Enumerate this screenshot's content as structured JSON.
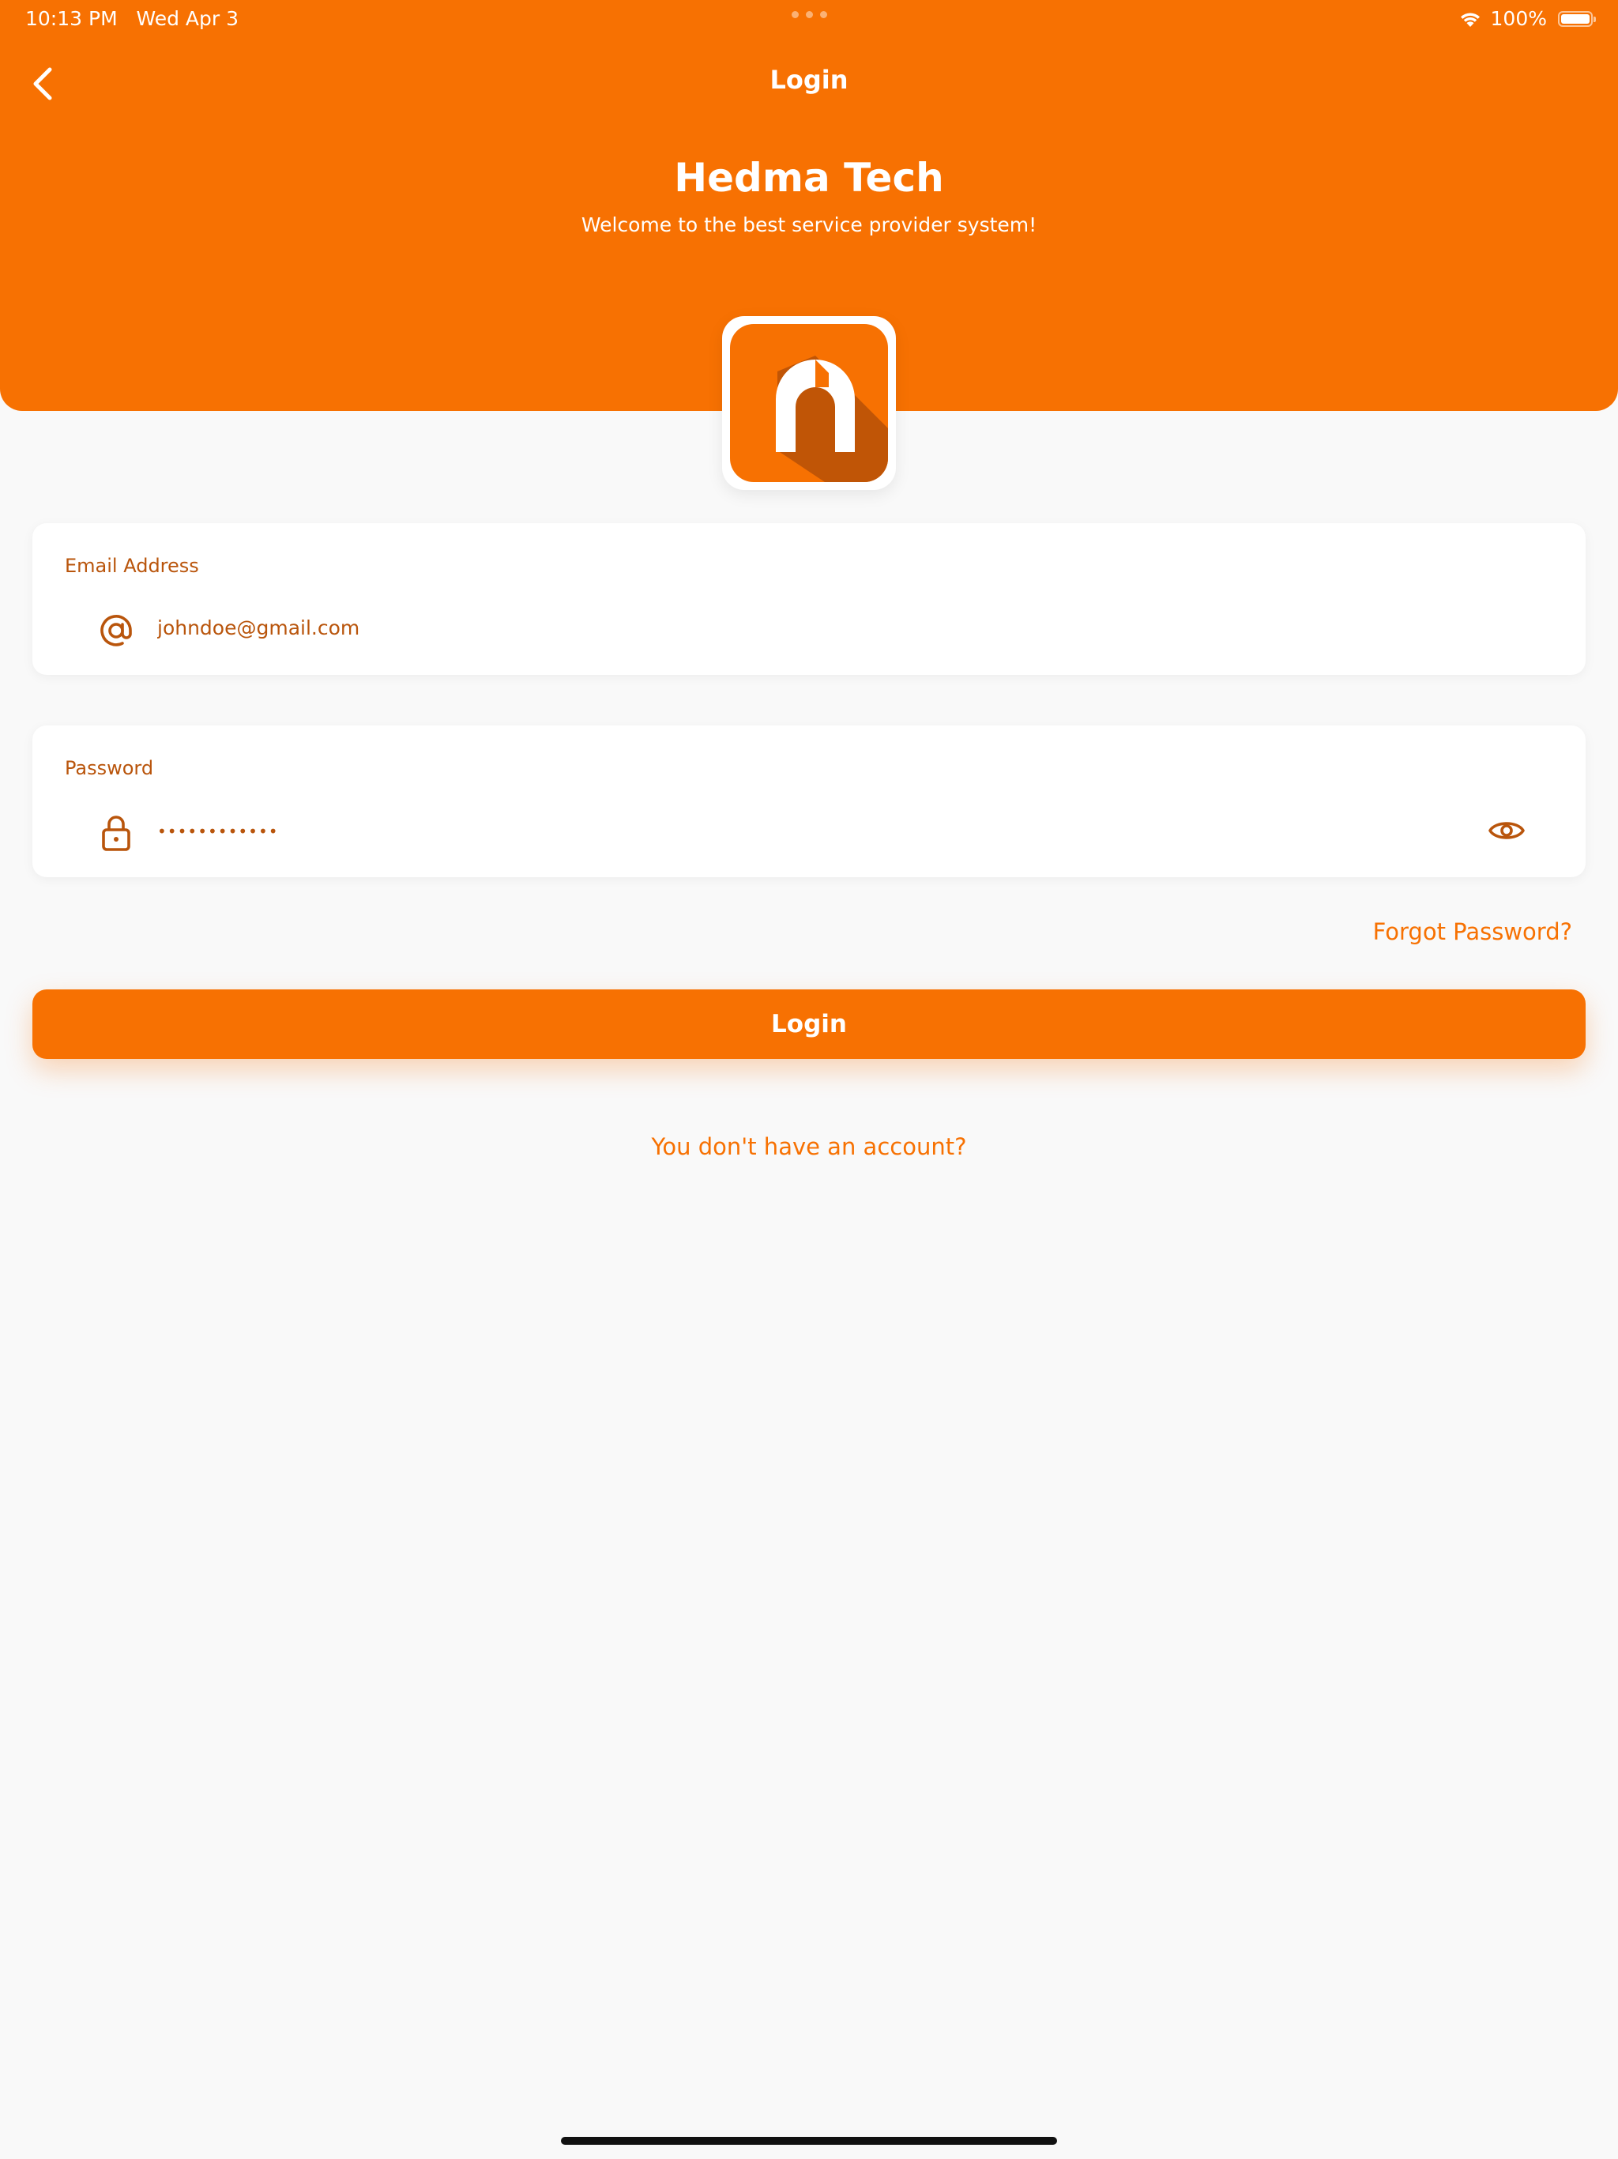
{
  "status_bar": {
    "time": "10:13 PM",
    "date": "Wed Apr 3",
    "battery": "100%"
  },
  "header": {
    "nav_title": "Login",
    "brand_title": "Hedma Tech",
    "brand_subtitle": "Welcome to the best service provider system!"
  },
  "form": {
    "email": {
      "label": "Email Address",
      "value": "johndoe@gmail.com",
      "icon": "at-icon"
    },
    "password": {
      "label": "Password",
      "value": "••••••••••••",
      "icon": "lock-icon",
      "toggle_icon": "eye-icon"
    },
    "forgot_label": "Forgot Password?",
    "login_label": "Login",
    "signup_label": "You don't have an account?"
  },
  "colors": {
    "primary": "#f77102",
    "text_dark_orange": "#b9550c",
    "background": "#f9f9f9"
  }
}
